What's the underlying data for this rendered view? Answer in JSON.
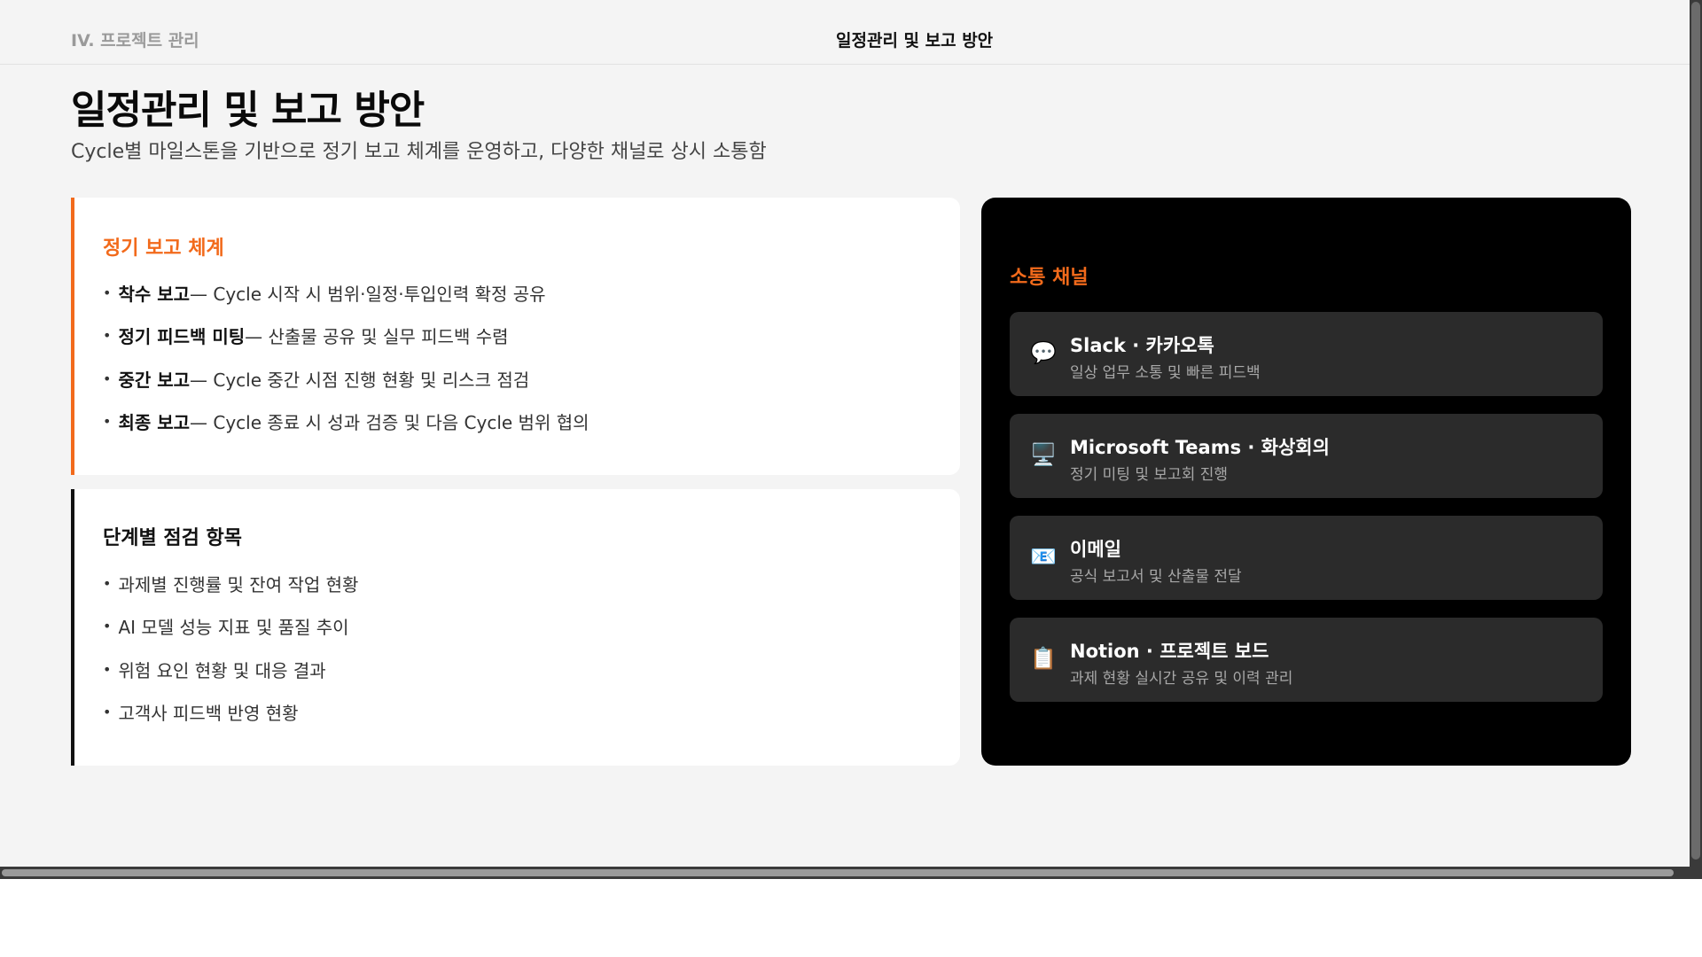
{
  "header": {
    "section_label": "IV. 프로젝트 관리",
    "title": "일정관리 및 보고 방안"
  },
  "page": {
    "title": "일정관리 및 보고 방안",
    "subtitle": "Cycle별 마일스톤을 기반으로 정기 보고 체계를 운영하고, 다양한 채널로 상시 소통함"
  },
  "report_card": {
    "heading": "정기 보고 체계",
    "items": [
      {
        "bold": "착수 보고",
        "text": " — Cycle 시작 시 범위·일정·투입인력 확정 공유"
      },
      {
        "bold": "정기 피드백 미팅",
        "text": " — 산출물 공유 및 실무 피드백 수렴"
      },
      {
        "bold": "중간 보고",
        "text": " — Cycle 중간 시점 진행 현황 및 리스크 점검"
      },
      {
        "bold": "최종 보고",
        "text": " — Cycle 종료 시 성과 검증 및 다음 Cycle 범위 협의"
      }
    ]
  },
  "check_card": {
    "heading": "단계별 점검 항목",
    "items": [
      "과제별 진행률 및 잔여 작업 현황",
      "AI 모델 성능 지표 및 품질 추이",
      "위험 요인 현황 및 대응 결과",
      "고객사 피드백 반영 현황"
    ]
  },
  "channels": {
    "heading": "소통 채널",
    "items": [
      {
        "icon": "speech-bubble-icon",
        "glyph": "💬",
        "name": "Slack · 카카오톡",
        "desc": "일상 업무 소통 및 빠른 피드백"
      },
      {
        "icon": "desktop-computer-icon",
        "glyph": "🖥️",
        "name": "Microsoft Teams · 화상회의",
        "desc": "정기 미팅 및 보고회 진행"
      },
      {
        "icon": "email-icon",
        "glyph": "📧",
        "name": "이메일",
        "desc": "공식 보고서 및 산출물 전달"
      },
      {
        "icon": "clipboard-icon",
        "glyph": "📋",
        "name": "Notion · 프로젝트 보드",
        "desc": "과제 현황 실시간 공유 및 이력 관리"
      }
    ]
  },
  "colors": {
    "accent": "#f26a1b",
    "panel_bg": "#000000",
    "channel_item_bg": "#2b2b2b"
  }
}
